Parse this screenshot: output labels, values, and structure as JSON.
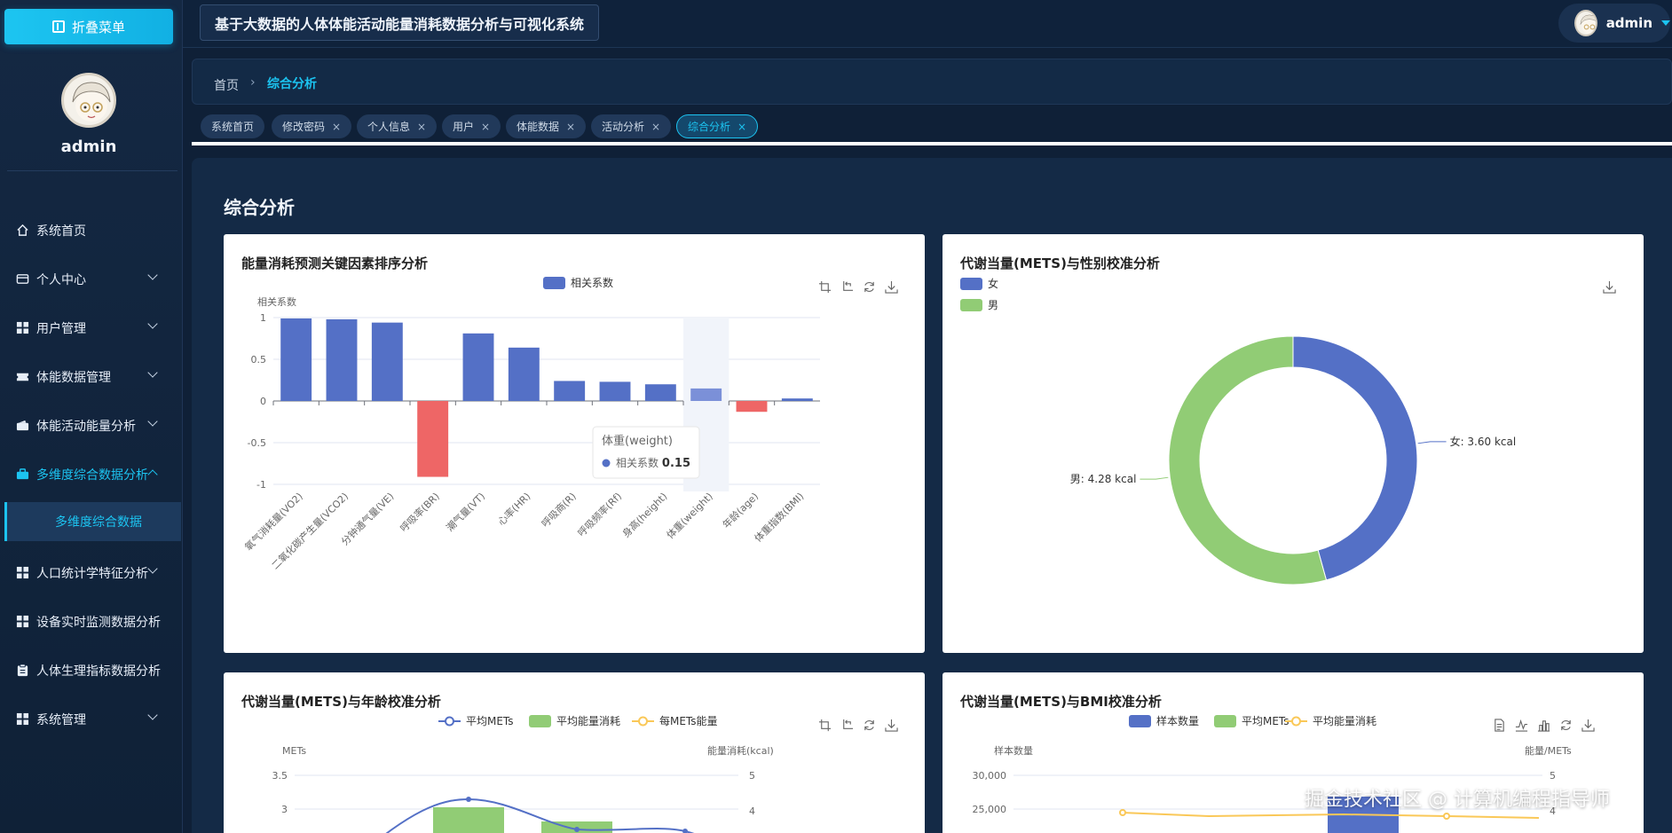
{
  "sidebar": {
    "collapse_label": "折叠菜单",
    "username": "admin",
    "items": [
      {
        "label": "系统首页",
        "icon": "home-icon"
      },
      {
        "label": "个人中心",
        "icon": "id-card-icon"
      },
      {
        "label": "用户管理",
        "icon": "grid-icon"
      },
      {
        "label": "体能数据管理",
        "icon": "ticket-icon"
      },
      {
        "label": "体能活动能量分析",
        "icon": "wallet-icon"
      },
      {
        "label": "多维度综合数据分析",
        "icon": "briefcase-icon"
      },
      {
        "label": "人口统计学特征分析",
        "icon": "grid-icon"
      },
      {
        "label": "设备实时监测数据分析",
        "icon": "grid-icon"
      },
      {
        "label": "人体生理指标数据分析",
        "icon": "clipboard-icon"
      },
      {
        "label": "系统管理",
        "icon": "grid-icon"
      }
    ],
    "submenu_label": "多维度综合数据"
  },
  "header": {
    "title": "基于大数据的人体体能活动能量消耗数据分析与可视化系统",
    "username": "admin"
  },
  "breadcrumb": {
    "home": "首页",
    "separator": "›",
    "current": "综合分析"
  },
  "tabs": [
    {
      "label": "系统首页",
      "closable": false
    },
    {
      "label": "修改密码",
      "closable": true
    },
    {
      "label": "个人信息",
      "closable": true
    },
    {
      "label": "用户",
      "closable": true
    },
    {
      "label": "体能数据",
      "closable": true
    },
    {
      "label": "活动分析",
      "closable": true
    },
    {
      "label": "综合分析",
      "closable": true,
      "active": true
    }
  ],
  "tab_close": "×",
  "page": {
    "title": "综合分析"
  },
  "cards": {
    "c1": {
      "title": "能量消耗预测关键因素排序分析"
    },
    "c2": {
      "title": "代谢当量(METS)与性别校准分析"
    },
    "c3": {
      "title": "代谢当量(METS)与年龄校准分析"
    },
    "c4": {
      "title": "代谢当量(METS)与BMI校准分析"
    }
  },
  "colors": {
    "accent": "#1cc3f0",
    "blue": "#5470c6",
    "green": "#91cc75",
    "red": "#ee6666",
    "yellow": "#fac858"
  },
  "chart_data": [
    {
      "type": "bar",
      "title": "能量消耗预测关键因素排序分析",
      "legend": [
        "相关系数"
      ],
      "ylabel": "相关系数",
      "ylim": [
        -1,
        1
      ],
      "yticks": [
        "1",
        "0.5",
        "0",
        "-0.5",
        "-1"
      ],
      "categories": [
        "氧气消耗量(VO2)",
        "二氧化碳产生量(VCO2)",
        "分钟通气量(VE)",
        "呼吸率(BR)",
        "潮气量(VT)",
        "心率(HR)",
        "呼吸商(R)",
        "呼吸频率(Rf)",
        "身高(height)",
        "体重(weight)",
        "年龄(age)",
        "体重指数(BMI)"
      ],
      "values": [
        0.99,
        0.98,
        0.94,
        -0.91,
        0.81,
        0.64,
        0.24,
        0.23,
        0.2,
        0.15,
        -0.13,
        0.03
      ],
      "tooltip": {
        "title": "体重(weight)",
        "series": "相关系数",
        "value": "0.15"
      }
    },
    {
      "type": "pie",
      "title": "代谢当量(METS)与性别校准分析",
      "legend": [
        "女",
        "男"
      ],
      "slices": [
        {
          "name": "女",
          "value": 3.6,
          "label": "女: 3.60 kcal"
        },
        {
          "name": "男",
          "value": 4.28,
          "label": "男: 4.28 kcal"
        }
      ]
    },
    {
      "type": "line",
      "title": "代谢当量(METS)与年龄校准分析",
      "legend": [
        "平均METs",
        "平均能量消耗",
        "每METs能量"
      ],
      "ylabel": "METs",
      "y2label": "能量消耗(kcal)",
      "yticks": [
        "3.5",
        "3"
      ],
      "y2ticks": [
        "5",
        "4"
      ]
    },
    {
      "type": "bar",
      "title": "代谢当量(METS)与BMI校准分析",
      "legend": [
        "样本数量",
        "平均METs",
        "平均能量消耗"
      ],
      "ylabel": "样本数量",
      "y2label": "能量/METs",
      "yticks": [
        "30,000",
        "25,000"
      ],
      "y2ticks": [
        "5",
        "4"
      ]
    }
  ],
  "watermark": "掘金技术社区 @ 计算机编程指导师"
}
